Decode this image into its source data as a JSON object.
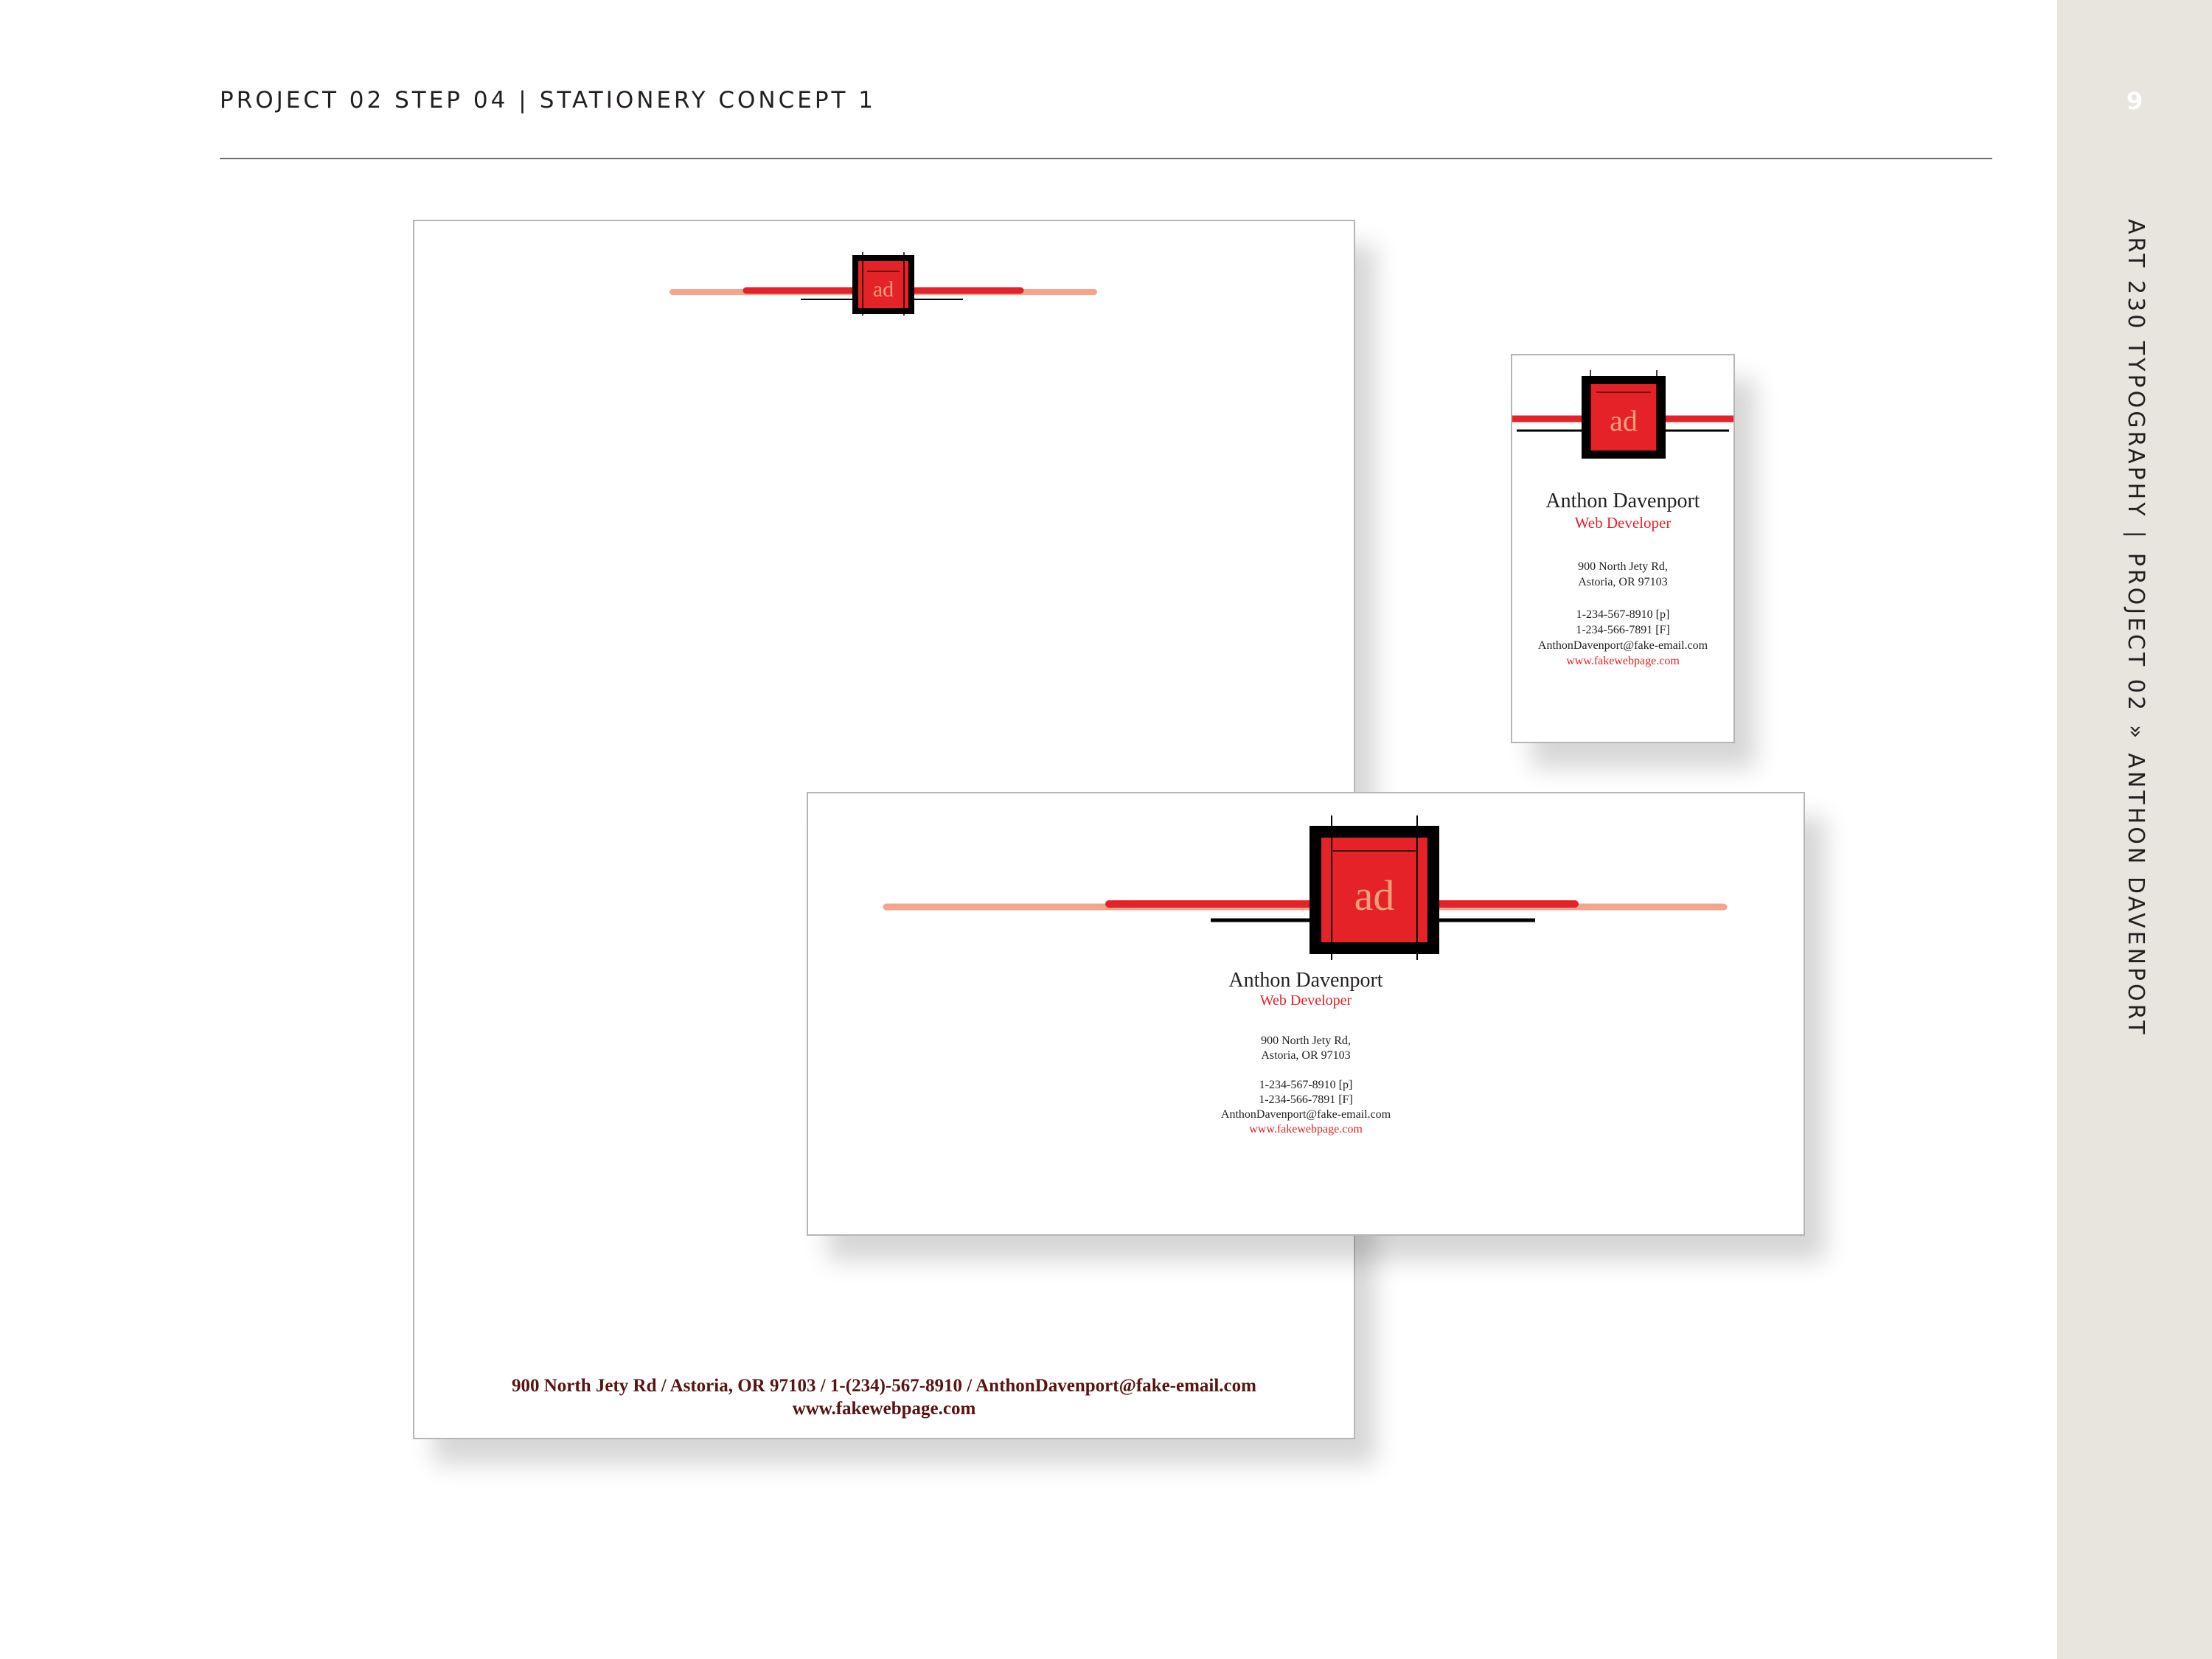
{
  "header": {
    "title_left": "PROJECT 02 STEP 04",
    "divider": "|",
    "title_right": "STATIONERY CONCEPT 1"
  },
  "sidebar": {
    "page_number": "9",
    "course": "ART 230 TYPOGRAPHY",
    "divider": "|",
    "project": "PROJECT 02",
    "chevron": "»",
    "author": "ANTHON DAVENPORT"
  },
  "logo": {
    "monogram": "ad",
    "colors": {
      "red": "#e42228",
      "salmon": "#f5a58c",
      "black": "#000000",
      "monogram": "#f3a07a"
    }
  },
  "letterhead": {
    "footer_line1": "900 North Jety Rd / Astoria, OR 97103 / 1-(234)-567-8910 / AnthonDavenport@fake-email.com",
    "footer_line2": "www.fakewebpage.com"
  },
  "card": {
    "name": "Anthon Davenport",
    "role": "Web Developer",
    "address_line1": "900 North Jety Rd,",
    "address_line2": "Astoria, OR 97103",
    "phone": "1-234-567-8910 [p]",
    "fax": "1-234-566-7891 [F]",
    "email": "AnthonDavenport@fake-email.com",
    "website": "www.fakewebpage.com"
  },
  "envelope": {
    "name": "Anthon Davenport",
    "role": "Web Developer",
    "address_line1": "900 North Jety Rd,",
    "address_line2": "Astoria, OR 97103",
    "phone": "1-234-567-8910 [p]",
    "fax": "1-234-566-7891 [F]",
    "email": "AnthonDavenport@fake-email.com",
    "website": "www.fakewebpage.com"
  }
}
